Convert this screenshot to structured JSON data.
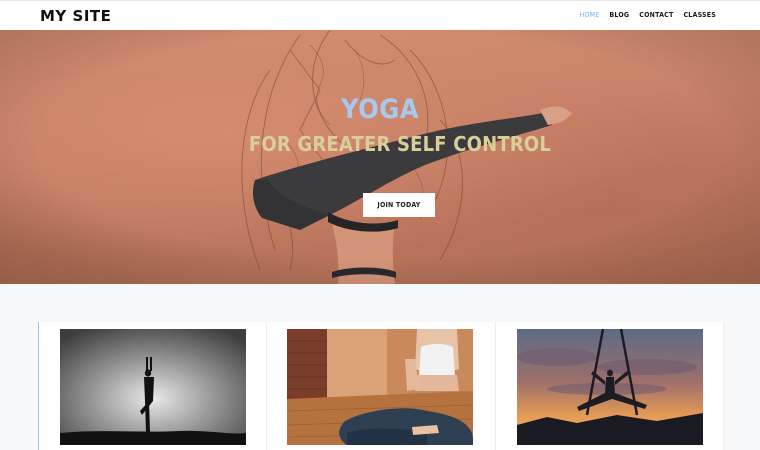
{
  "header": {
    "logo": "MY SITE",
    "nav": [
      {
        "label": "HOME",
        "active": true
      },
      {
        "label": "BLOG",
        "active": false
      },
      {
        "label": "CONTACT",
        "active": false
      },
      {
        "label": "CLASSES",
        "active": false
      }
    ]
  },
  "hero": {
    "title": "YOGA",
    "subtitle": "FOR GREATER SELF CONTROL",
    "cta_label": "JOIN TODAY",
    "title_color": "#a7c9ef",
    "subtitle_color": "#d8cf9a",
    "background_color": "#c98468"
  },
  "cards": [
    {
      "image": "yoga-tree-pose-silhouette-photo"
    },
    {
      "image": "yoga-meditation-pose-photo"
    },
    {
      "image": "aerial-yoga-sunset-photo"
    }
  ],
  "colors": {
    "accent": "#7cb7e8",
    "page_background": "#f7f8f9"
  }
}
